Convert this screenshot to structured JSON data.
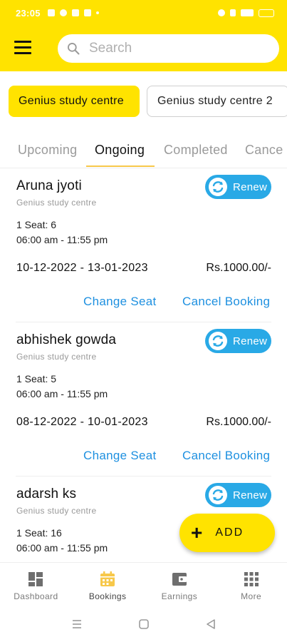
{
  "status_bar": {
    "time": "23:05"
  },
  "search": {
    "placeholder": "Search"
  },
  "centres": [
    "Genius study centre",
    "Genius study centre 2"
  ],
  "tabs": [
    "Upcoming",
    "Ongoing",
    "Completed",
    "Cance"
  ],
  "bookings": [
    {
      "name": "Aruna jyoti",
      "centre": "Genius study centre",
      "seat": "1 Seat: 6",
      "timing": "06:00 am - 11:55 pm",
      "dates": "10-12-2022 - 13-01-2023",
      "price": "Rs.1000.00/-",
      "renew_label": "Renew",
      "change_seat_label": "Change Seat",
      "cancel_label": "Cancel Booking"
    },
    {
      "name": "abhishek gowda",
      "centre": "Genius study centre",
      "seat": "1 Seat: 5",
      "timing": "06:00 am - 11:55 pm",
      "dates": "08-12-2022 - 10-01-2023",
      "price": "Rs.1000.00/-",
      "renew_label": "Renew",
      "change_seat_label": "Change Seat",
      "cancel_label": "Cancel Booking"
    },
    {
      "name": "adarsh ks",
      "centre": "Genius study centre",
      "seat": "1 Seat: 16",
      "timing": "06:00 am - 11:55 pm",
      "renew_label": "Renew"
    }
  ],
  "fab": {
    "label": "ADD"
  },
  "bottom_nav": [
    "Dashboard",
    "Bookings",
    "Earnings",
    "More"
  ],
  "colors": {
    "accent": "#ffe300",
    "link": "#1e90e0",
    "renew": "#29a9e6",
    "nav_active": "#f7c84a"
  }
}
